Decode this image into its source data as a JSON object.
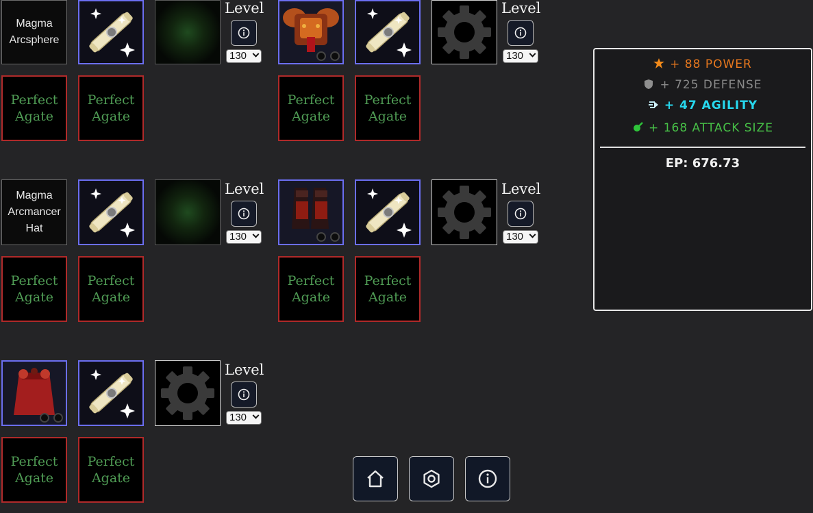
{
  "rows": [
    {
      "left": {
        "item_name": "Magma Arcsphere",
        "third_slot": "green",
        "level_label": "Level",
        "level_value": "130"
      },
      "right": {
        "item_image": "magma-chest-armor",
        "third_slot": "gear",
        "level_label": "Level",
        "level_value": "130"
      },
      "gems": [
        "Perfect Agate",
        "Perfect Agate",
        "Perfect Agate",
        "Perfect Agate"
      ]
    },
    {
      "left": {
        "item_name": "Magma Arcmancer Hat",
        "third_slot": "green",
        "level_label": "Level",
        "level_value": "130"
      },
      "right": {
        "item_image": "magma-gauntlets",
        "third_slot": "gear",
        "level_label": "Level",
        "level_value": "130"
      },
      "gems": [
        "Perfect Agate",
        "Perfect Agate",
        "Perfect Agate",
        "Perfect Agate"
      ]
    },
    {
      "left": {
        "item_image": "magma-cape",
        "third_slot": "gear",
        "level_label": "Level",
        "level_value": "130"
      },
      "gems": [
        "Perfect Agate",
        "Perfect Agate"
      ]
    }
  ],
  "stats_panel": {
    "stats": [
      {
        "text": "+ 88 POWER",
        "icon": "power-icon",
        "color": "#e8781e"
      },
      {
        "text": "+ 725 DEFENSE",
        "icon": "shield-icon",
        "color": "#8a8a8a"
      },
      {
        "text": "+ 47 AGILITY",
        "icon": "agility-icon",
        "color": "#27d8ee"
      },
      {
        "text": "+ 168 ATTACK SIZE",
        "icon": "attack-size-icon",
        "color": "#47c047"
      }
    ],
    "ep_text": "EP: 676.73"
  },
  "nav": [
    {
      "icon": "home-icon"
    },
    {
      "icon": "hexagon-settings-icon"
    },
    {
      "icon": "info-icon"
    }
  ]
}
